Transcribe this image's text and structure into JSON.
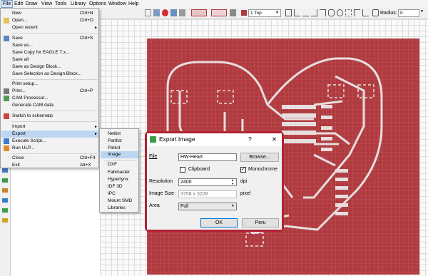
{
  "menubar": {
    "items": [
      "File",
      "Edit",
      "Draw",
      "View",
      "Tools",
      "Library",
      "Options",
      "Window",
      "Help"
    ]
  },
  "toolbar": {
    "layer_select": "1 Top",
    "radius_label": "Radius:",
    "radius_value": "0"
  },
  "file_menu": {
    "items": [
      {
        "label": "New",
        "shortcut": "Ctrl+N"
      },
      {
        "label": "Open...",
        "shortcut": "Ctrl+O"
      },
      {
        "label": "Open recent"
      },
      {
        "label": "Save",
        "shortcut": "Ctrl+S"
      },
      {
        "label": "Save as..."
      },
      {
        "label": "Save Copy for EAGLE 7.x..."
      },
      {
        "label": "Save all"
      },
      {
        "label": "Save as Design Block..."
      },
      {
        "label": "Save Selection as Design Block..."
      },
      {
        "label": "Print setup..."
      },
      {
        "label": "Print...",
        "shortcut": "Ctrl+P"
      },
      {
        "label": "CAM Processor..."
      },
      {
        "label": "Generate CAM data"
      },
      {
        "label": "Switch to schematic"
      },
      {
        "label": "Import"
      },
      {
        "label": "Export"
      },
      {
        "label": "Execute Script..."
      },
      {
        "label": "Run ULP..."
      },
      {
        "label": "Close",
        "shortcut": "Ctrl+F4"
      },
      {
        "label": "Exit",
        "shortcut": "Alt+X"
      }
    ]
  },
  "export_menu": {
    "items": [
      "Netlist",
      "Partlist",
      "Pinlist",
      "Image",
      "DXF",
      "Fabmaster",
      "Hyperlynx",
      "IDF 3D",
      "IPC",
      "Mount SMD",
      "Libraries"
    ]
  },
  "dialog": {
    "title": "Export Image",
    "help_glyph": "?",
    "close_glyph": "✕",
    "file_label": "File",
    "file_value": "HW-Heart",
    "browse_label": "Browse...",
    "clipboard_label": "Clipboard",
    "monochrome_label": "Monochrome",
    "monochrome_checked": true,
    "clipboard_checked": false,
    "resolution_label": "Resolution",
    "resolution_value": "2400",
    "resolution_unit": "dpi",
    "image_size_label": "Image Size",
    "image_size_value": "3758 x 3228",
    "image_size_unit": "pixel",
    "area_label": "Area",
    "area_value": "Full",
    "ok_label": "OK",
    "cancel_label": "Peru"
  },
  "colors": {
    "board": "#b03a3f",
    "trace": "#e8dede",
    "dialog_border": "#b22234",
    "menu_highlight": "#bcd6f2"
  }
}
